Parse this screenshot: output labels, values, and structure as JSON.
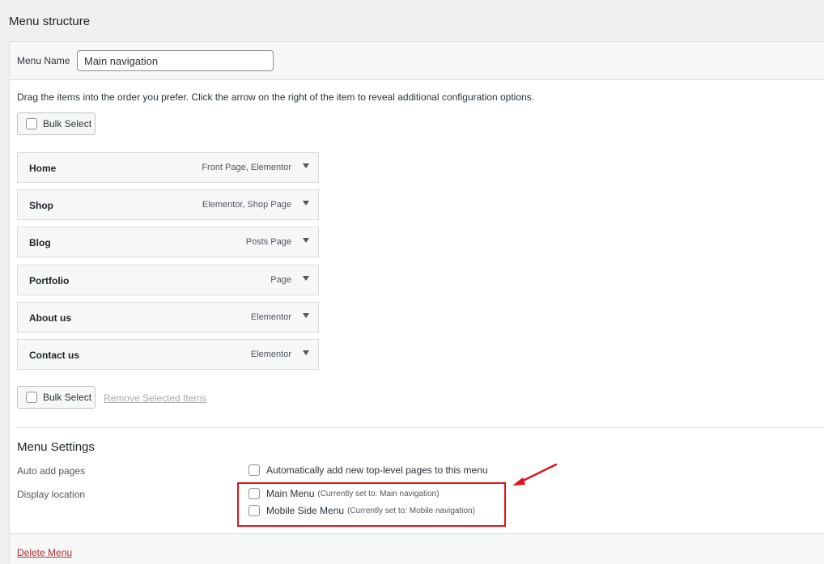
{
  "page_title": "Menu structure",
  "menu_name": {
    "label": "Menu Name",
    "value": "Main navigation"
  },
  "instructions": "Drag the items into the order you prefer. Click the arrow on the right of the item to reveal additional configuration options.",
  "bulk_select_label": "Bulk Select",
  "menu_items": [
    {
      "title": "Home",
      "type": "Front Page, Elementor"
    },
    {
      "title": "Shop",
      "type": "Elementor, Shop Page"
    },
    {
      "title": "Blog",
      "type": "Posts Page"
    },
    {
      "title": "Portfolio",
      "type": "Page"
    },
    {
      "title": "About us",
      "type": "Elementor"
    },
    {
      "title": "Contact us",
      "type": "Elementor"
    }
  ],
  "remove_selected_label": "Remove Selected Items",
  "settings": {
    "heading": "Menu Settings",
    "auto_add_label": "Auto add pages",
    "auto_add_option": "Automatically add new top-level pages to this menu",
    "display_location_label": "Display location",
    "locations": [
      {
        "label": "Main Menu",
        "note": "(Currently set to: Main navigation)"
      },
      {
        "label": "Mobile Side Menu",
        "note": "(Currently set to: Mobile navigation)"
      }
    ]
  },
  "delete_menu_label": "Delete Menu",
  "colors": {
    "annotation_red": "#e0141b",
    "delete_red": "#b32d2e"
  }
}
